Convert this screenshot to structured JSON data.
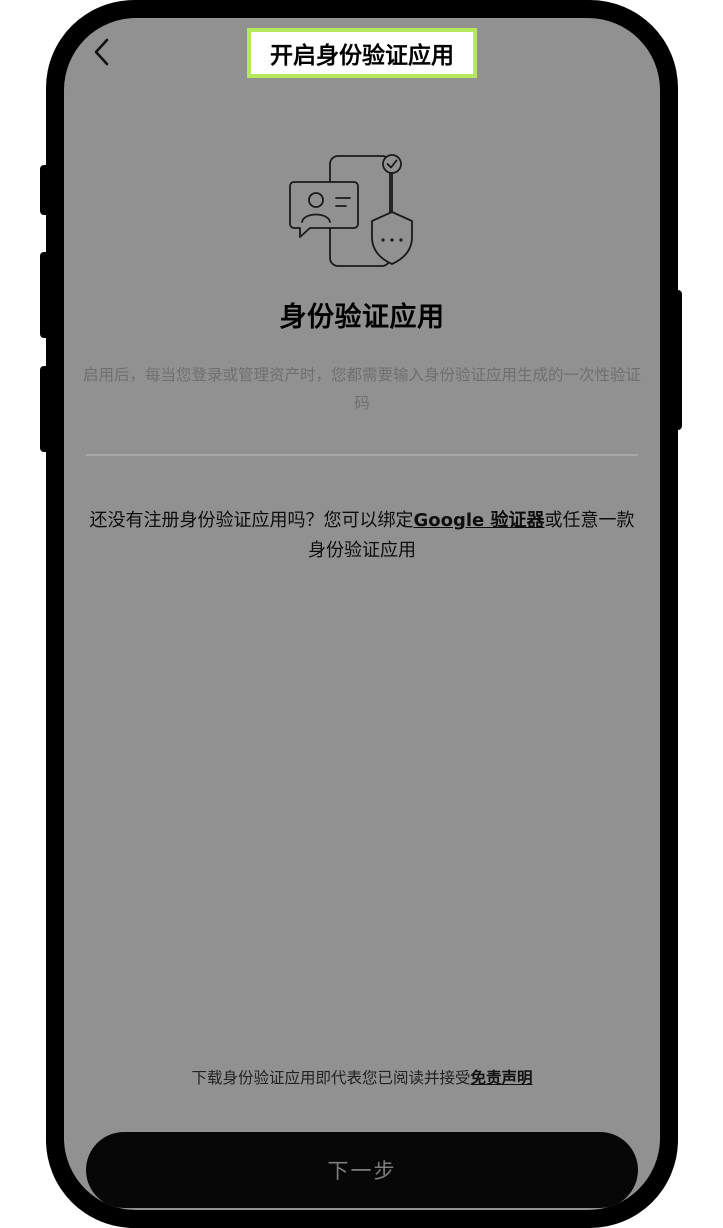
{
  "header": {
    "back_icon": "chevron-left-icon",
    "title": "开启身份验证应用"
  },
  "hero": {
    "icon": "authenticator-app-illustration"
  },
  "main": {
    "heading": "身份验证应用",
    "description": "启用后，每当您登录或管理资产时，您都需要输入身份验证应用生成的一次性验证码",
    "prompt_before": "还没有注册身份验证应用吗？您可以绑定",
    "prompt_link": "Google 验证器",
    "prompt_after": "或任意一款身份验证应用"
  },
  "footer": {
    "disclaimer_before": "下载身份验证应用即代表您已阅读并接受",
    "disclaimer_link": "免责声明",
    "next_label": "下一步"
  },
  "colors": {
    "screen_bg": "#919191",
    "title_highlight": "#b5e85a",
    "button_bg": "#070707"
  }
}
